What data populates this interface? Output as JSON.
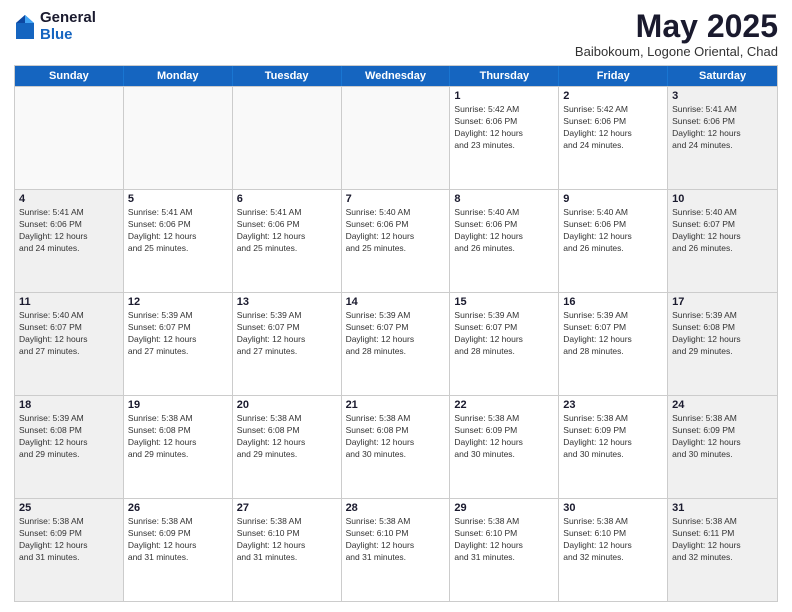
{
  "header": {
    "logo_general": "General",
    "logo_blue": "Blue",
    "month_title": "May 2025",
    "subtitle": "Baibokoum, Logone Oriental, Chad"
  },
  "days": [
    "Sunday",
    "Monday",
    "Tuesday",
    "Wednesday",
    "Thursday",
    "Friday",
    "Saturday"
  ],
  "rows": [
    [
      {
        "day": "",
        "lines": []
      },
      {
        "day": "",
        "lines": []
      },
      {
        "day": "",
        "lines": []
      },
      {
        "day": "",
        "lines": []
      },
      {
        "day": "1",
        "lines": [
          "Sunrise: 5:42 AM",
          "Sunset: 6:06 PM",
          "Daylight: 12 hours",
          "and 23 minutes."
        ]
      },
      {
        "day": "2",
        "lines": [
          "Sunrise: 5:42 AM",
          "Sunset: 6:06 PM",
          "Daylight: 12 hours",
          "and 24 minutes."
        ]
      },
      {
        "day": "3",
        "lines": [
          "Sunrise: 5:41 AM",
          "Sunset: 6:06 PM",
          "Daylight: 12 hours",
          "and 24 minutes."
        ]
      }
    ],
    [
      {
        "day": "4",
        "lines": [
          "Sunrise: 5:41 AM",
          "Sunset: 6:06 PM",
          "Daylight: 12 hours",
          "and 24 minutes."
        ]
      },
      {
        "day": "5",
        "lines": [
          "Sunrise: 5:41 AM",
          "Sunset: 6:06 PM",
          "Daylight: 12 hours",
          "and 25 minutes."
        ]
      },
      {
        "day": "6",
        "lines": [
          "Sunrise: 5:41 AM",
          "Sunset: 6:06 PM",
          "Daylight: 12 hours",
          "and 25 minutes."
        ]
      },
      {
        "day": "7",
        "lines": [
          "Sunrise: 5:40 AM",
          "Sunset: 6:06 PM",
          "Daylight: 12 hours",
          "and 25 minutes."
        ]
      },
      {
        "day": "8",
        "lines": [
          "Sunrise: 5:40 AM",
          "Sunset: 6:06 PM",
          "Daylight: 12 hours",
          "and 26 minutes."
        ]
      },
      {
        "day": "9",
        "lines": [
          "Sunrise: 5:40 AM",
          "Sunset: 6:06 PM",
          "Daylight: 12 hours",
          "and 26 minutes."
        ]
      },
      {
        "day": "10",
        "lines": [
          "Sunrise: 5:40 AM",
          "Sunset: 6:07 PM",
          "Daylight: 12 hours",
          "and 26 minutes."
        ]
      }
    ],
    [
      {
        "day": "11",
        "lines": [
          "Sunrise: 5:40 AM",
          "Sunset: 6:07 PM",
          "Daylight: 12 hours",
          "and 27 minutes."
        ]
      },
      {
        "day": "12",
        "lines": [
          "Sunrise: 5:39 AM",
          "Sunset: 6:07 PM",
          "Daylight: 12 hours",
          "and 27 minutes."
        ]
      },
      {
        "day": "13",
        "lines": [
          "Sunrise: 5:39 AM",
          "Sunset: 6:07 PM",
          "Daylight: 12 hours",
          "and 27 minutes."
        ]
      },
      {
        "day": "14",
        "lines": [
          "Sunrise: 5:39 AM",
          "Sunset: 6:07 PM",
          "Daylight: 12 hours",
          "and 28 minutes."
        ]
      },
      {
        "day": "15",
        "lines": [
          "Sunrise: 5:39 AM",
          "Sunset: 6:07 PM",
          "Daylight: 12 hours",
          "and 28 minutes."
        ]
      },
      {
        "day": "16",
        "lines": [
          "Sunrise: 5:39 AM",
          "Sunset: 6:07 PM",
          "Daylight: 12 hours",
          "and 28 minutes."
        ]
      },
      {
        "day": "17",
        "lines": [
          "Sunrise: 5:39 AM",
          "Sunset: 6:08 PM",
          "Daylight: 12 hours",
          "and 29 minutes."
        ]
      }
    ],
    [
      {
        "day": "18",
        "lines": [
          "Sunrise: 5:39 AM",
          "Sunset: 6:08 PM",
          "Daylight: 12 hours",
          "and 29 minutes."
        ]
      },
      {
        "day": "19",
        "lines": [
          "Sunrise: 5:38 AM",
          "Sunset: 6:08 PM",
          "Daylight: 12 hours",
          "and 29 minutes."
        ]
      },
      {
        "day": "20",
        "lines": [
          "Sunrise: 5:38 AM",
          "Sunset: 6:08 PM",
          "Daylight: 12 hours",
          "and 29 minutes."
        ]
      },
      {
        "day": "21",
        "lines": [
          "Sunrise: 5:38 AM",
          "Sunset: 6:08 PM",
          "Daylight: 12 hours",
          "and 30 minutes."
        ]
      },
      {
        "day": "22",
        "lines": [
          "Sunrise: 5:38 AM",
          "Sunset: 6:09 PM",
          "Daylight: 12 hours",
          "and 30 minutes."
        ]
      },
      {
        "day": "23",
        "lines": [
          "Sunrise: 5:38 AM",
          "Sunset: 6:09 PM",
          "Daylight: 12 hours",
          "and 30 minutes."
        ]
      },
      {
        "day": "24",
        "lines": [
          "Sunrise: 5:38 AM",
          "Sunset: 6:09 PM",
          "Daylight: 12 hours",
          "and 30 minutes."
        ]
      }
    ],
    [
      {
        "day": "25",
        "lines": [
          "Sunrise: 5:38 AM",
          "Sunset: 6:09 PM",
          "Daylight: 12 hours",
          "and 31 minutes."
        ]
      },
      {
        "day": "26",
        "lines": [
          "Sunrise: 5:38 AM",
          "Sunset: 6:09 PM",
          "Daylight: 12 hours",
          "and 31 minutes."
        ]
      },
      {
        "day": "27",
        "lines": [
          "Sunrise: 5:38 AM",
          "Sunset: 6:10 PM",
          "Daylight: 12 hours",
          "and 31 minutes."
        ]
      },
      {
        "day": "28",
        "lines": [
          "Sunrise: 5:38 AM",
          "Sunset: 6:10 PM",
          "Daylight: 12 hours",
          "and 31 minutes."
        ]
      },
      {
        "day": "29",
        "lines": [
          "Sunrise: 5:38 AM",
          "Sunset: 6:10 PM",
          "Daylight: 12 hours",
          "and 31 minutes."
        ]
      },
      {
        "day": "30",
        "lines": [
          "Sunrise: 5:38 AM",
          "Sunset: 6:10 PM",
          "Daylight: 12 hours",
          "and 32 minutes."
        ]
      },
      {
        "day": "31",
        "lines": [
          "Sunrise: 5:38 AM",
          "Sunset: 6:11 PM",
          "Daylight: 12 hours",
          "and 32 minutes."
        ]
      }
    ]
  ]
}
